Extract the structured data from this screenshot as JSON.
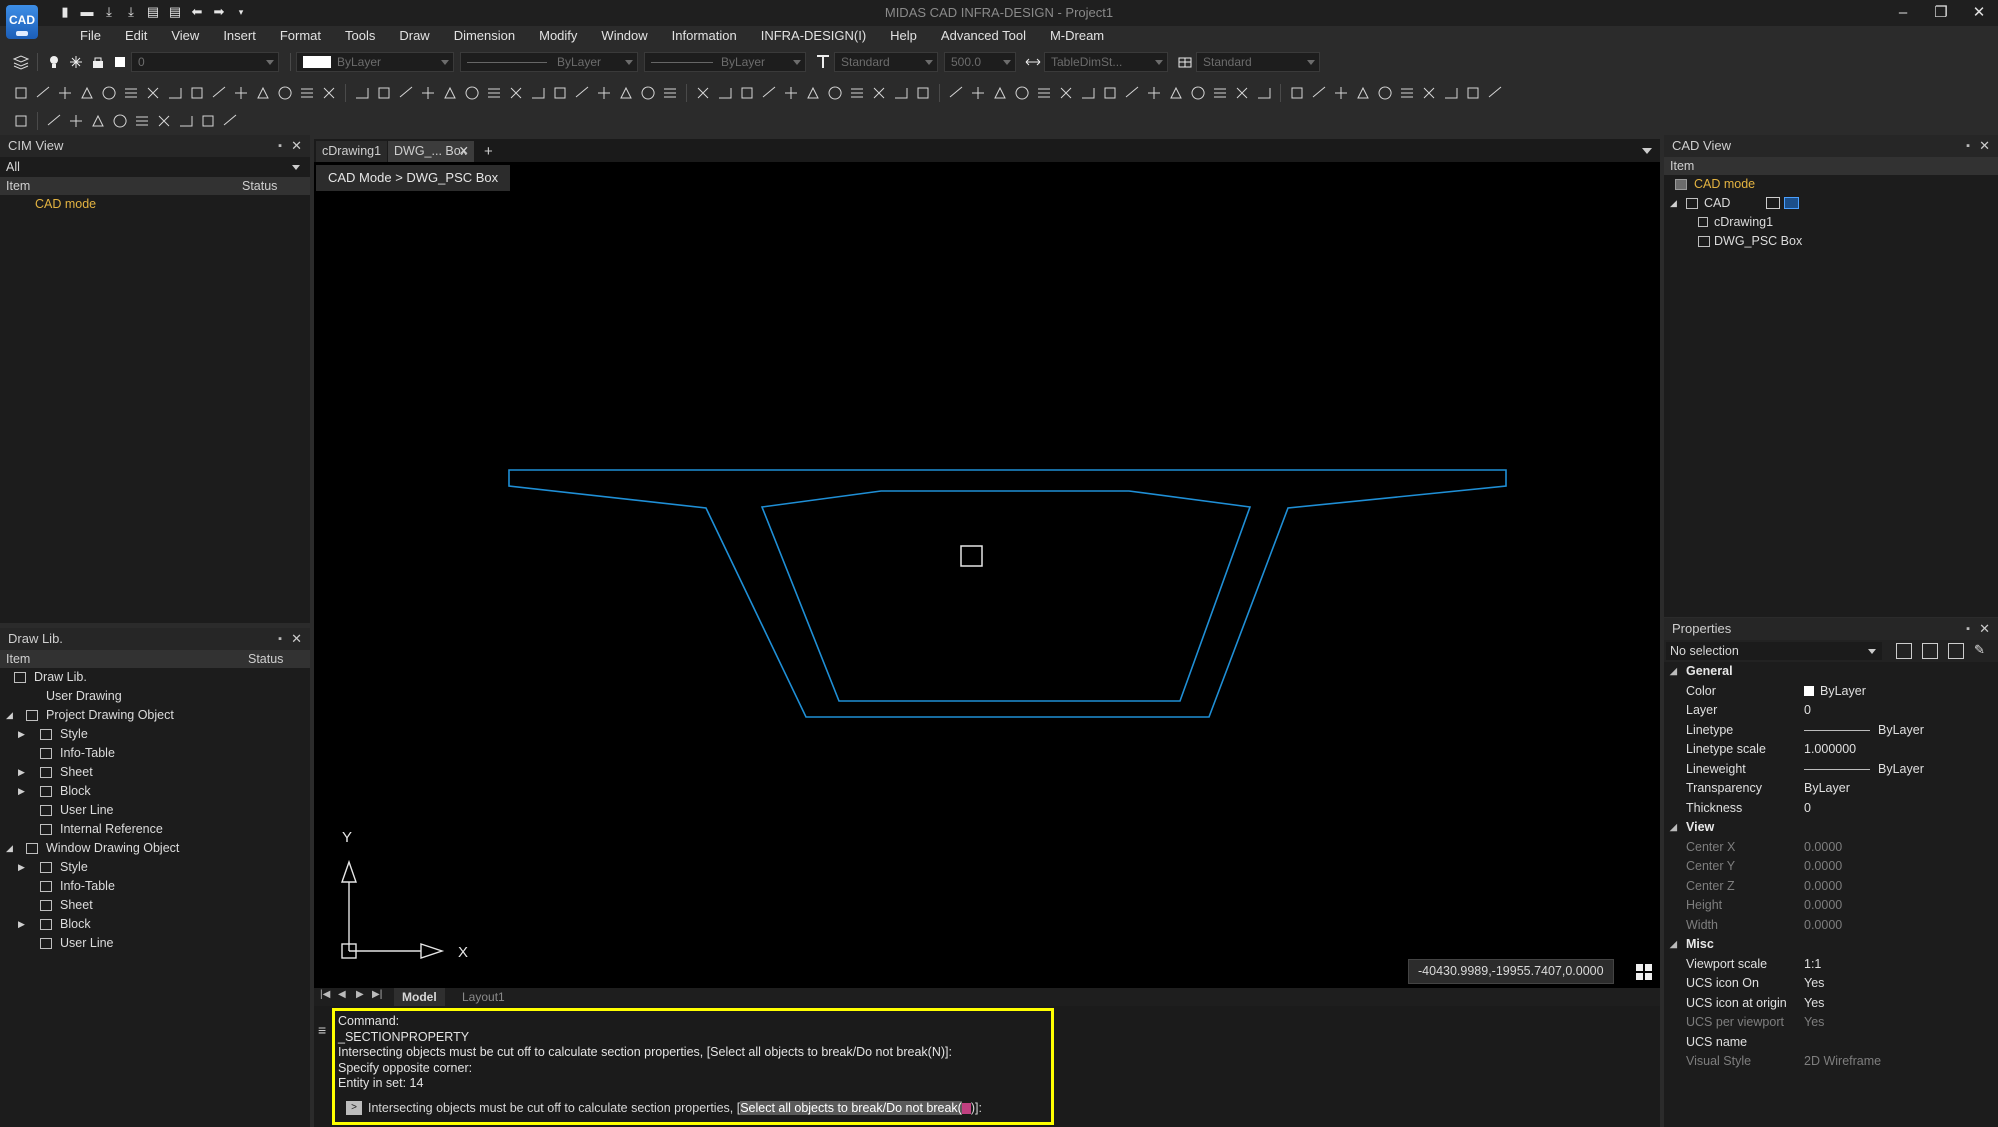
{
  "app": {
    "logo": "CAD",
    "title": "MIDAS CAD INFRA-DESIGN - Project1"
  },
  "menu": [
    "File",
    "Edit",
    "View",
    "Insert",
    "Format",
    "Tools",
    "Draw",
    "Dimension",
    "Modify",
    "Window",
    "Information",
    "INFRA-DESIGN(I)",
    "Help",
    "Advanced Tool",
    "M-Dream"
  ],
  "toolbar": {
    "layer_value": "0",
    "color_value": "ByLayer",
    "linetype_value": "ByLayer",
    "lineweight_value": "ByLayer",
    "text_style": "Standard",
    "text_height": "500.0",
    "dim_style": "TableDimSt...",
    "table_style": "Standard"
  },
  "cim_view": {
    "title": "CIM View",
    "filter": "All",
    "col_item": "Item",
    "col_status": "Status",
    "items": [
      {
        "label": "CAD mode"
      }
    ]
  },
  "draw_lib": {
    "title": "Draw Lib.",
    "col_item": "Item",
    "col_status": "Status",
    "items": [
      "Draw Lib.",
      "User Drawing",
      "Project Drawing Object",
      "Style",
      "Info-Table",
      "Sheet",
      "Block",
      "User Line",
      "Internal Reference",
      "Window Drawing Object",
      "Style",
      "Info-Table",
      "Sheet",
      "Block",
      "User Line"
    ]
  },
  "tabs": [
    "cDrawing1",
    "DWG_... Box"
  ],
  "breadcrumb": "CAD Mode > DWG_PSC Box",
  "coordinates": "-40430.9989,-19955.7407,0.0000",
  "ucs": {
    "x": "X",
    "y": "Y"
  },
  "layout_tabs": [
    "Model",
    "Layout1"
  ],
  "command": {
    "lines": [
      "Command:",
      "_SECTIONPROPERTY",
      "Intersecting objects must be cut off to calculate section properties, [Select all objects to break/Do not break(N)]:",
      "Specify opposite corner:",
      "Entity in set: 14"
    ],
    "prompt_text": "Intersecting objects must be cut off to calculate section properties, [",
    "prompt_highlight": "Select all objects to break/Do not break(",
    "prompt_end": ")]:"
  },
  "cad_view": {
    "title": "CAD View",
    "col_item": "Item",
    "items": [
      "CAD mode",
      "CAD",
      "cDrawing1",
      "DWG_PSC Box"
    ]
  },
  "properties": {
    "title": "Properties",
    "selection": "No selection",
    "groups": [
      {
        "name": "General",
        "rows": [
          [
            "Color",
            "ByLayer"
          ],
          [
            "Layer",
            "0"
          ],
          [
            "Linetype",
            "ByLayer"
          ],
          [
            "Linetype scale",
            "1.000000"
          ],
          [
            "Lineweight",
            "ByLayer"
          ],
          [
            "Transparency",
            "ByLayer"
          ],
          [
            "Thickness",
            "0"
          ]
        ]
      },
      {
        "name": "View",
        "rows": [
          [
            "Center X",
            "0.0000"
          ],
          [
            "Center Y",
            "0.0000"
          ],
          [
            "Center Z",
            "0.0000"
          ],
          [
            "Height",
            "0.0000"
          ],
          [
            "Width",
            "0.0000"
          ]
        ]
      },
      {
        "name": "Misc",
        "rows": [
          [
            "Viewport scale",
            "1:1"
          ],
          [
            "UCS icon On",
            "Yes"
          ],
          [
            "UCS icon at origin",
            "Yes"
          ],
          [
            "UCS per viewport",
            "Yes"
          ],
          [
            "UCS name",
            ""
          ],
          [
            "Visual Style",
            "2D Wireframe"
          ]
        ]
      }
    ]
  },
  "colors": {
    "accent": "#ffff00",
    "section": "#1f8fd6",
    "folder": "#e3b341"
  }
}
